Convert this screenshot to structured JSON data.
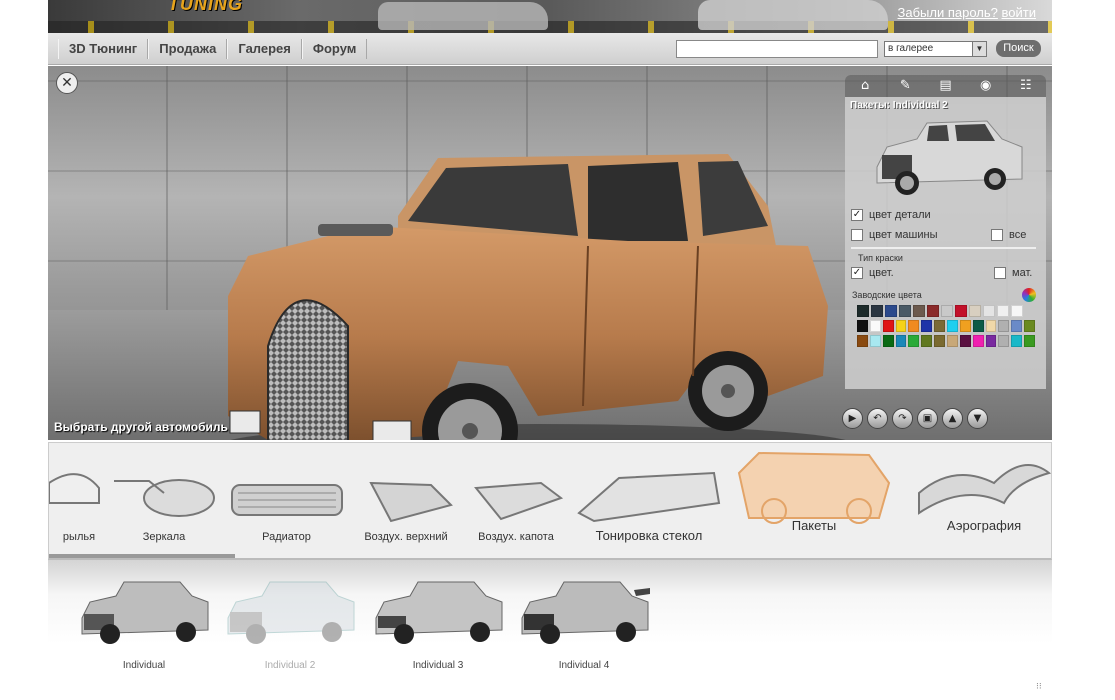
{
  "header": {
    "logo_text": "TUNING",
    "forgot_password": "Забыли пароль?",
    "login": "войти"
  },
  "nav": {
    "items": [
      "3D Тюнинг",
      "Продажа",
      "Галерея",
      "Форум"
    ]
  },
  "search": {
    "value": "",
    "scope": "в галерее",
    "button": "Поиск"
  },
  "viewport": {
    "choose_car": "Выбрать другой автомобиль",
    "car_color": "#b77b4c"
  },
  "panel": {
    "title": "Пакеты: Individual 2",
    "part_color": {
      "label": "цвет детали",
      "checked": true
    },
    "car_color": {
      "label": "цвет машины",
      "checked": false
    },
    "all": {
      "label": "все",
      "checked": false
    },
    "paint_type_label": "Тип краски",
    "glossy": {
      "label": "цвет.",
      "checked": true
    },
    "matte": {
      "label": "мат.",
      "checked": false
    },
    "factory_colors_label": "Заводские цвета",
    "swatches": [
      [
        "#1d2b2a",
        "#2a3540",
        "#2c4a8c",
        "#4a5a66",
        "#6c5a4e",
        "#8a2a2a",
        "#c9c9c9",
        "#c2102a",
        "#d8cfc0",
        "#e4e4e4",
        "#f0f0f0",
        "#f7f7f7"
      ],
      [
        "#111111",
        "#fafafa",
        "#e01515",
        "#f5d21a",
        "#f08a20",
        "#1e34a8",
        "#7a6a36",
        "#1ecff0",
        "#f0a020",
        "#0c5a46",
        "#f0d8a8",
        "#b0b0b0",
        "#6a8ac8",
        "#6a8a20"
      ],
      [
        "#8a4a10",
        "#a8e8f0",
        "#0a6a14",
        "#1a88b8",
        "#2aaa38",
        "#607820",
        "#7a6a30",
        "#c8a878",
        "#5a1040",
        "#f020b0",
        "#7a2aa0",
        "#b0b0b0",
        "#1ab8c8",
        "#3a9a20"
      ]
    ]
  },
  "top_icons": [
    "home-icon",
    "tuning-icon",
    "print-icon",
    "camera-icon",
    "sitemap-icon"
  ],
  "controls": [
    "play-icon",
    "rotate-left-icon",
    "rotate-right-icon",
    "save-icon",
    "upload-icon",
    "download-icon"
  ],
  "parts": [
    {
      "label": "рылья"
    },
    {
      "label": "Зеркала"
    },
    {
      "label": "Радиатор"
    },
    {
      "label": "Воздух. верхний"
    },
    {
      "label": "Воздух. капота"
    },
    {
      "label": "Тонировка стекол"
    },
    {
      "label": "Пакеты"
    },
    {
      "label": "Аэрография"
    }
  ],
  "packages": [
    {
      "label": "Individual"
    },
    {
      "label": "Individual 2"
    },
    {
      "label": "Individual 3"
    },
    {
      "label": "Individual 4"
    }
  ]
}
